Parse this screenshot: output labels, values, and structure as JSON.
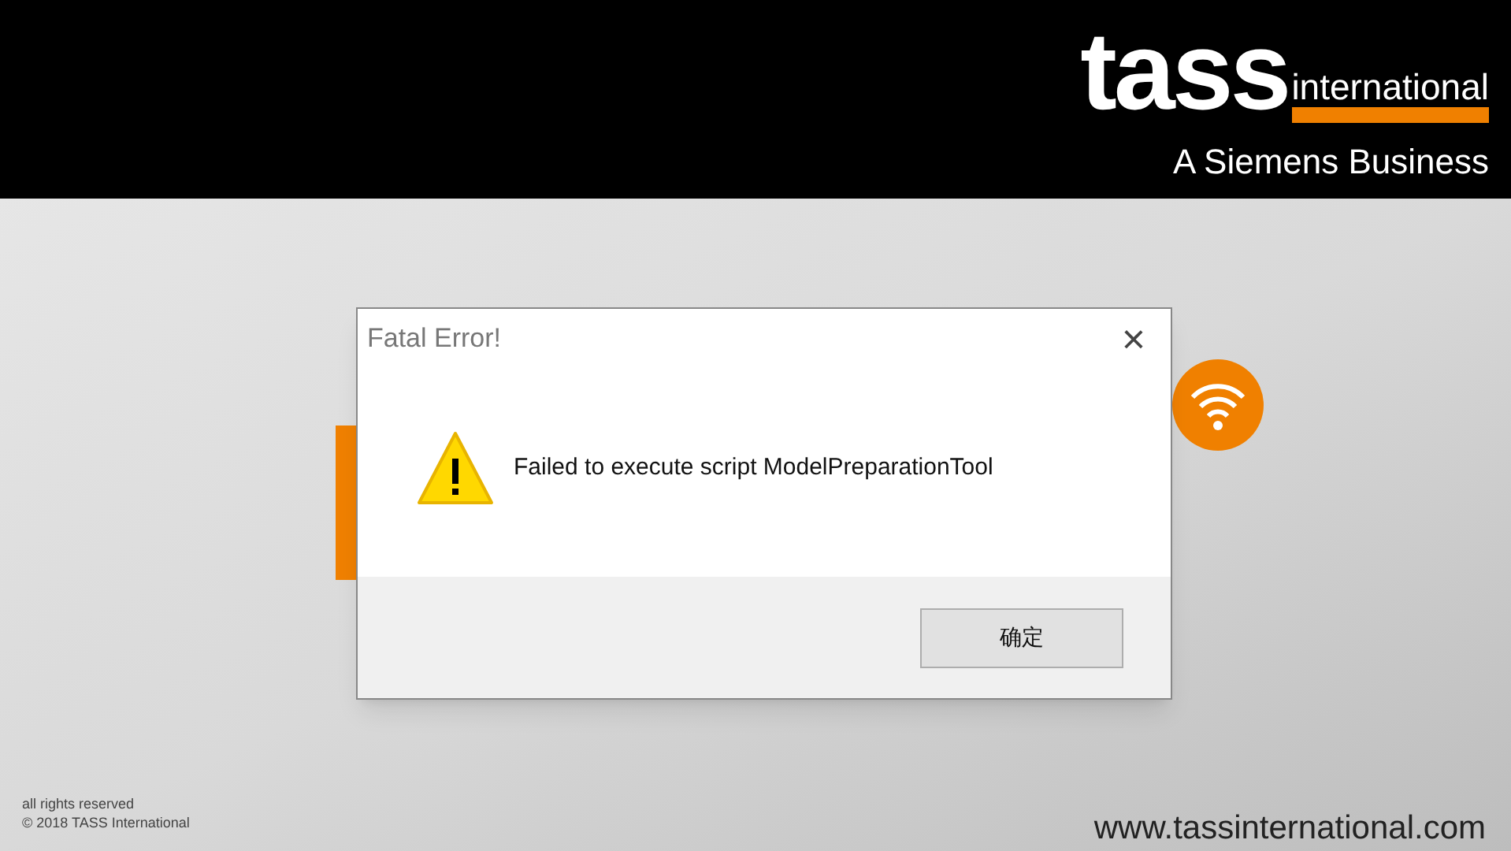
{
  "header": {
    "logo_word": "tass",
    "logo_suffix": "international",
    "tagline": "A Siemens Business"
  },
  "footer": {
    "rights": "all rights reserved",
    "copyright": "© 2018 TASS International",
    "website": "www.tassinternational.com"
  },
  "dialog": {
    "title": "Fatal Error!",
    "close": "×",
    "message": "Failed to execute script ModelPreparationTool",
    "buttons": [
      "确定"
    ]
  }
}
